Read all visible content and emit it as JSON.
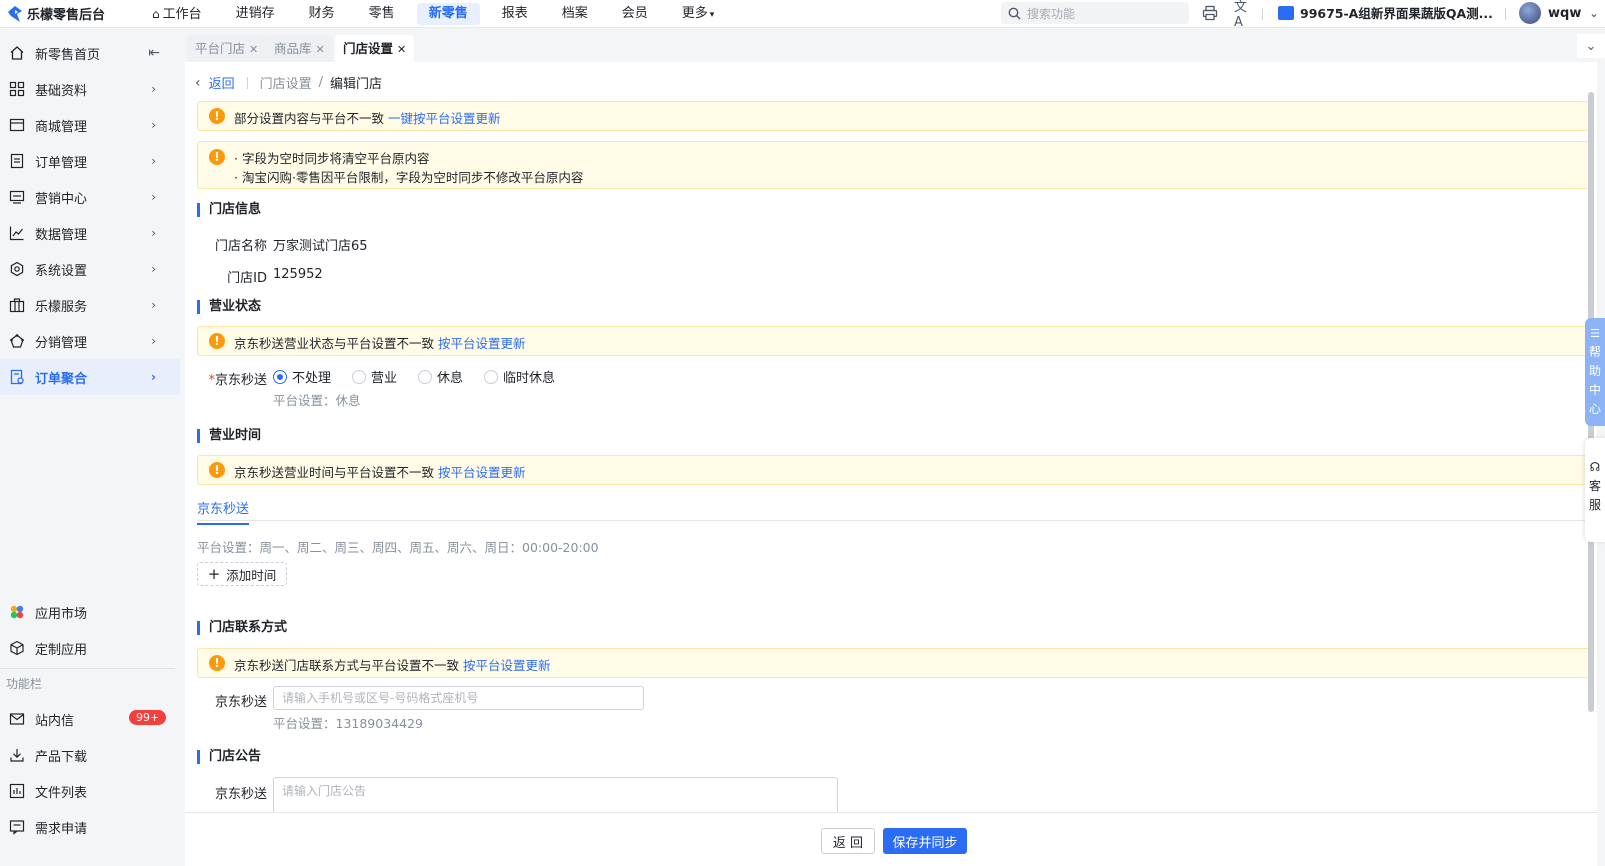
{
  "app": {
    "title": "乐檬零售后台"
  },
  "topnav": {
    "items": [
      "工作台",
      "进销存",
      "财务",
      "零售",
      "新零售",
      "报表",
      "档案",
      "会员",
      "更多"
    ],
    "active_index": 4,
    "search_placeholder": "搜索功能",
    "store_name": "99675-A组新界面果蔬版QA测...",
    "user_name": "wqw"
  },
  "sidebar": {
    "items": [
      {
        "label": "新零售首页",
        "icon": "home-icon"
      },
      {
        "label": "基础资料",
        "icon": "grid-icon"
      },
      {
        "label": "商城管理",
        "icon": "mall-icon"
      },
      {
        "label": "订单管理",
        "icon": "order-icon"
      },
      {
        "label": "营销中心",
        "icon": "marketing-icon"
      },
      {
        "label": "数据管理",
        "icon": "chart-icon"
      },
      {
        "label": "系统设置",
        "icon": "settings-icon"
      },
      {
        "label": "乐檬服务",
        "icon": "service-icon"
      },
      {
        "label": "分销管理",
        "icon": "distribution-icon"
      },
      {
        "label": "订单聚合",
        "icon": "order-aggregate-icon"
      }
    ],
    "active_index": 9,
    "bottom_items": [
      {
        "label": "应用市场",
        "icon": "app-market-icon"
      },
      {
        "label": "定制应用",
        "icon": "custom-app-icon"
      }
    ],
    "section_label": "功能栏",
    "function_items": [
      {
        "label": "站内信",
        "icon": "mail-icon",
        "badge": "99+"
      },
      {
        "label": "产品下载",
        "icon": "download-icon"
      },
      {
        "label": "文件列表",
        "icon": "file-list-icon"
      },
      {
        "label": "需求申请",
        "icon": "request-icon"
      }
    ]
  },
  "tabs": [
    {
      "label": "平台门店",
      "active": false
    },
    {
      "label": "商品库",
      "active": false
    },
    {
      "label": "门店设置",
      "active": true
    }
  ],
  "breadcrumb": {
    "back": "返回",
    "parent": "门店设置",
    "current": "编辑门店"
  },
  "alerts": {
    "top": {
      "text": "部分设置内容与平台不一致",
      "link": "一键按平台设置更新"
    },
    "notes": [
      "· 字段为空时同步将清空平台原内容",
      "· 淘宝闪购·零售因平台限制，字段为空时同步不修改平台原内容"
    ],
    "status": {
      "text": "京东秒送营业状态与平台设置不一致",
      "link": "按平台设置更新"
    },
    "hours": {
      "text": "京东秒送营业时间与平台设置不一致",
      "link": "按平台设置更新"
    },
    "contact": {
      "text": "京东秒送门店联系方式与平台设置不一致",
      "link": "按平台设置更新"
    }
  },
  "store_info": {
    "title": "门店信息",
    "name_label": "门店名称",
    "name_value": "万家测试门店65",
    "id_label": "门店ID",
    "id_value": "125952"
  },
  "business_status": {
    "title": "营业状态",
    "channel_label": "京东秒送",
    "required_mark": "*",
    "options": [
      "不处理",
      "营业",
      "休息",
      "临时休息"
    ],
    "selected_index": 0,
    "platform_setting": "平台设置：休息"
  },
  "business_hours": {
    "title": "营业时间",
    "tab": "京东秒送",
    "platform_setting": "平台设置：周一、周二、周三、周四、周五、周六、周日：00:00-20:00",
    "add_button": "添加时间"
  },
  "contact": {
    "title": "门店联系方式",
    "channel_label": "京东秒送",
    "placeholder": "请输入手机号或区号-号码格式座机号",
    "platform_setting": "平台设置：13189034429"
  },
  "notice": {
    "title": "门店公告",
    "channel_label": "京东秒送",
    "placeholder": "请输入门店公告"
  },
  "footer": {
    "back_button": "返 回",
    "save_button": "保存并同步"
  },
  "floating": {
    "help": [
      "帮",
      "助",
      "中",
      "心"
    ],
    "service": [
      "客",
      "服"
    ]
  }
}
